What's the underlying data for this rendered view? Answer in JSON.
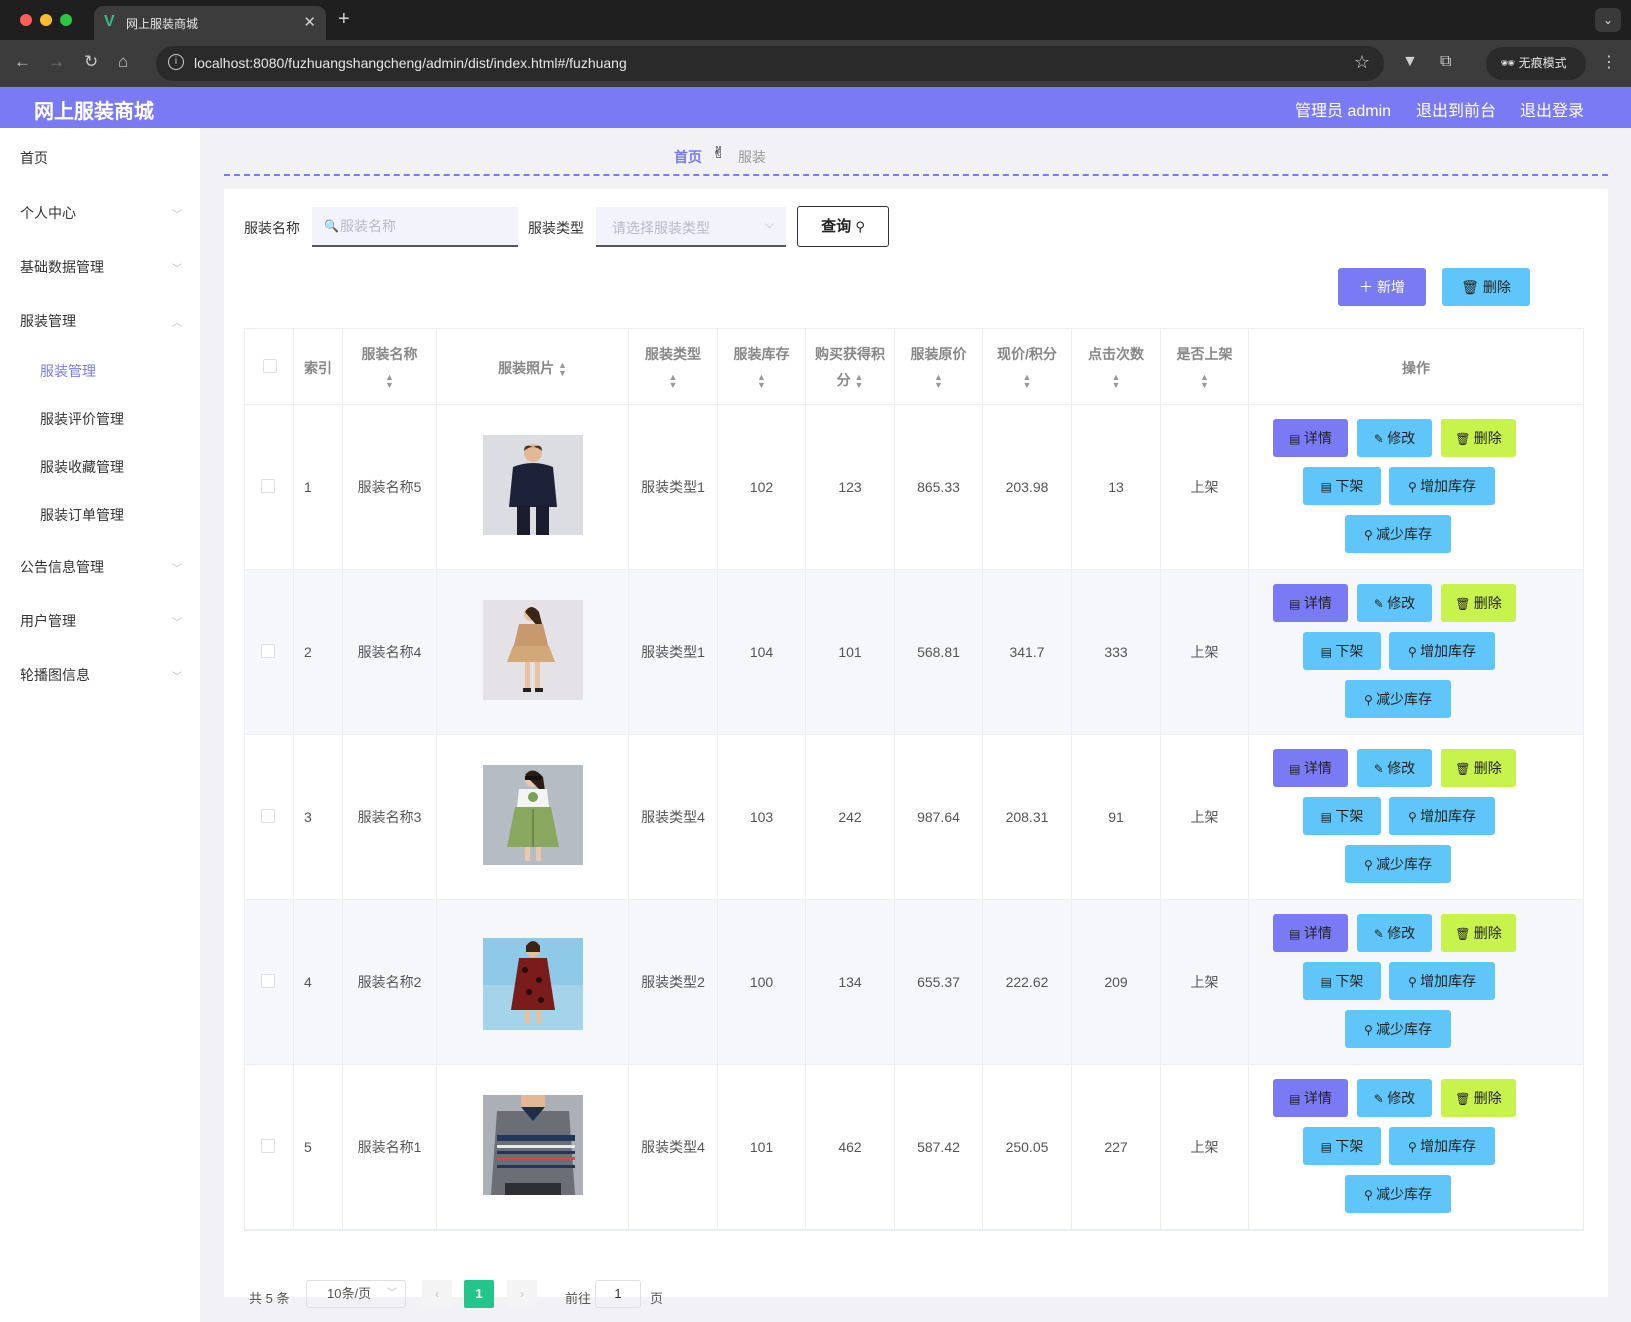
{
  "browser": {
    "tab_title": "网上服装商城",
    "url": "localhost:8080/fuzhuangshangcheng/admin/dist/index.html#/fuzhuang",
    "incognito_label": "无痕模式"
  },
  "header": {
    "brand": "网上服装商城",
    "admin_label": "管理员 admin",
    "to_front_label": "退出到前台",
    "logout_label": "退出登录"
  },
  "sidebar": {
    "items": [
      {
        "label": "首页"
      },
      {
        "label": "个人中心"
      },
      {
        "label": "基础数据管理"
      },
      {
        "label": "服装管理"
      },
      {
        "label": "公告信息管理"
      },
      {
        "label": "用户管理"
      },
      {
        "label": "轮播图信息"
      }
    ],
    "sub_items": [
      {
        "label": "服装管理"
      },
      {
        "label": "服装评价管理"
      },
      {
        "label": "服装收藏管理"
      },
      {
        "label": "服装订单管理"
      }
    ]
  },
  "breadcrumb": {
    "home": "首页",
    "sep": "✌",
    "current": "服装"
  },
  "search": {
    "name_label": "服装名称",
    "name_placeholder": "服装名称",
    "type_label": "服装类型",
    "type_placeholder": "请选择服装类型",
    "query_label": "查询"
  },
  "actions": {
    "add_label": "新增",
    "delete_label": "删除"
  },
  "table": {
    "headers": {
      "index": "索引",
      "name": "服装名称",
      "photo": "服装照片",
      "type": "服装类型",
      "stock": "服装库存",
      "points_line1": "购买获得积",
      "points_line2": "分",
      "orig_price": "服装原价",
      "cur_price": "现价/积分",
      "clicks": "点击次数",
      "onsale": "是否上架",
      "ops": "操作"
    },
    "op_labels": {
      "detail": "详情",
      "edit": "修改",
      "delete": "删除",
      "offshelf": "下架",
      "add_stock": "增加库存",
      "reduce_stock": "减少库存"
    },
    "rows": [
      {
        "index": "1",
        "name": "服装名称5",
        "type": "服装类型1",
        "stock": "102",
        "points": "123",
        "orig_price": "865.33",
        "cur_price": "203.98",
        "clicks": "13",
        "onsale": "上架"
      },
      {
        "index": "2",
        "name": "服装名称4",
        "type": "服装类型1",
        "stock": "104",
        "points": "101",
        "orig_price": "568.81",
        "cur_price": "341.7",
        "clicks": "333",
        "onsale": "上架"
      },
      {
        "index": "3",
        "name": "服装名称3",
        "type": "服装类型4",
        "stock": "103",
        "points": "242",
        "orig_price": "987.64",
        "cur_price": "208.31",
        "clicks": "91",
        "onsale": "上架"
      },
      {
        "index": "4",
        "name": "服装名称2",
        "type": "服装类型2",
        "stock": "100",
        "points": "134",
        "orig_price": "655.37",
        "cur_price": "222.62",
        "clicks": "209",
        "onsale": "上架"
      },
      {
        "index": "5",
        "name": "服装名称1",
        "type": "服装类型4",
        "stock": "101",
        "points": "462",
        "orig_price": "587.42",
        "cur_price": "250.05",
        "clicks": "227",
        "onsale": "上架"
      }
    ]
  },
  "pagination": {
    "total": "共 5 条",
    "page_size": "10条/页",
    "current_page": "1",
    "goto_label": "前往",
    "goto_value": "1",
    "page_suffix": "页"
  },
  "colors": {
    "primary": "#7b7af5",
    "info": "#60c6f9",
    "lime": "#c8f24c",
    "pager_active": "#22c58b"
  }
}
